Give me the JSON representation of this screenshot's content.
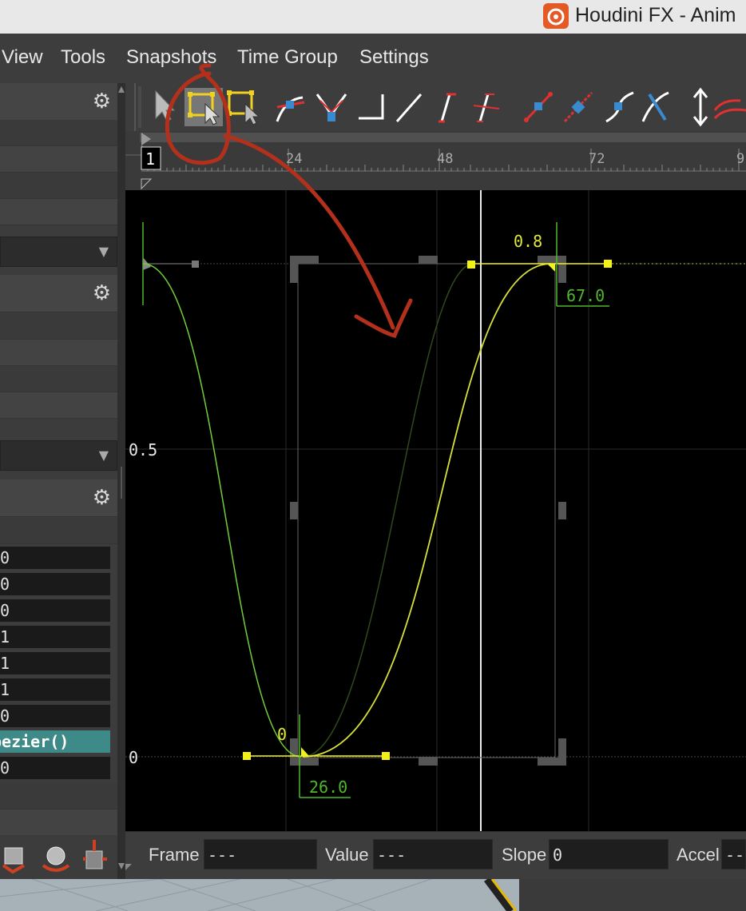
{
  "window": {
    "title": "Houdini FX - Anim"
  },
  "menu": [
    "View",
    "Tools",
    "Snapshots",
    "Time Group",
    "Settings"
  ],
  "ruler": {
    "current_frame": "1",
    "ticks": [
      "24",
      "48",
      "72",
      "9"
    ]
  },
  "graph": {
    "y_labels": [
      "0.5",
      "0"
    ],
    "key_top": {
      "value": "0.8",
      "frame": "67.0"
    },
    "key_bottom": {
      "value": "0",
      "frame": "26.0"
    }
  },
  "left_panel": {
    "fields": [
      "0",
      "0",
      "0",
      "1",
      "1",
      "1",
      "0",
      "bezier()",
      "0"
    ]
  },
  "bottom_bar": {
    "frame_label": "Frame",
    "frame_value": "---",
    "value_label": "Value",
    "value_value": "---",
    "slope_label": "Slope",
    "slope_value": "0",
    "accel_label": "Accel",
    "accel_value": "--"
  },
  "colors": {
    "curve_green": "#6fce3a",
    "curve_yellow": "#e0e83a",
    "key_yellow": "#f2f21a",
    "annotation_red": "#b3301c",
    "toolbar_bg": "#3d3d3d"
  }
}
